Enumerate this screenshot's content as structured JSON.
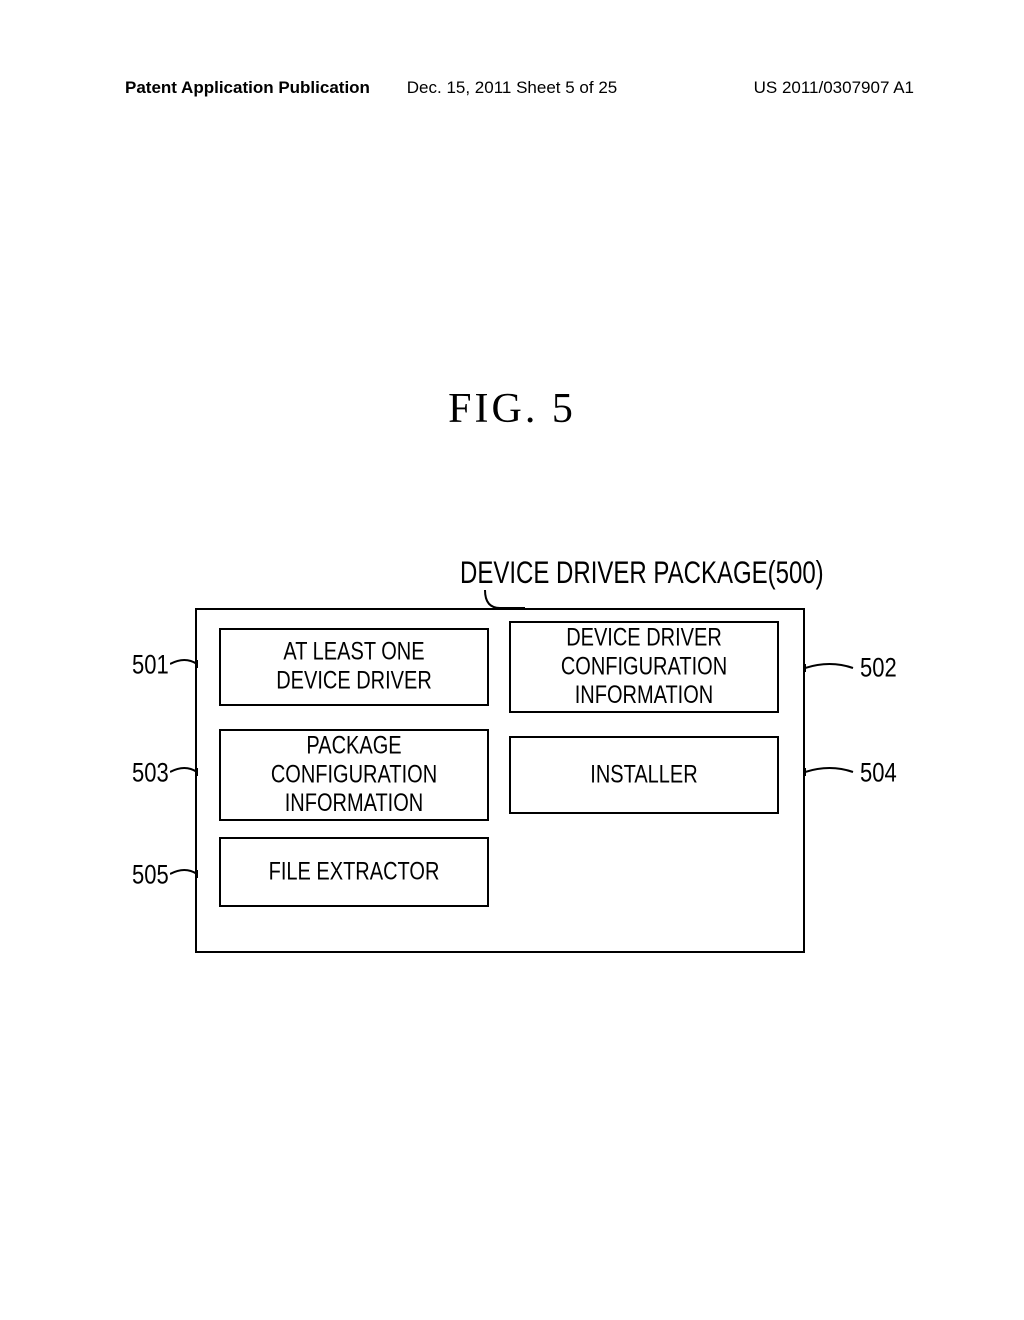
{
  "header": {
    "left": "Patent Application Publication",
    "center": "Dec. 15, 2011  Sheet 5 of 25",
    "right": "US 2011/0307907 A1"
  },
  "figure_title": "FIG. 5",
  "package_label": "DEVICE DRIVER PACKAGE(500)",
  "boxes": {
    "b501": "AT LEAST ONE\nDEVICE DRIVER",
    "b502": "DEVICE DRIVER\nCONFIGURATION\nINFORMATION",
    "b503": "PACKAGE\nCONFIGURATION\nINFORMATION",
    "b504": "INSTALLER",
    "b505": "FILE EXTRACTOR"
  },
  "refs": {
    "r501": "501",
    "r502": "502",
    "r503": "503",
    "r504": "504",
    "r505": "505"
  }
}
